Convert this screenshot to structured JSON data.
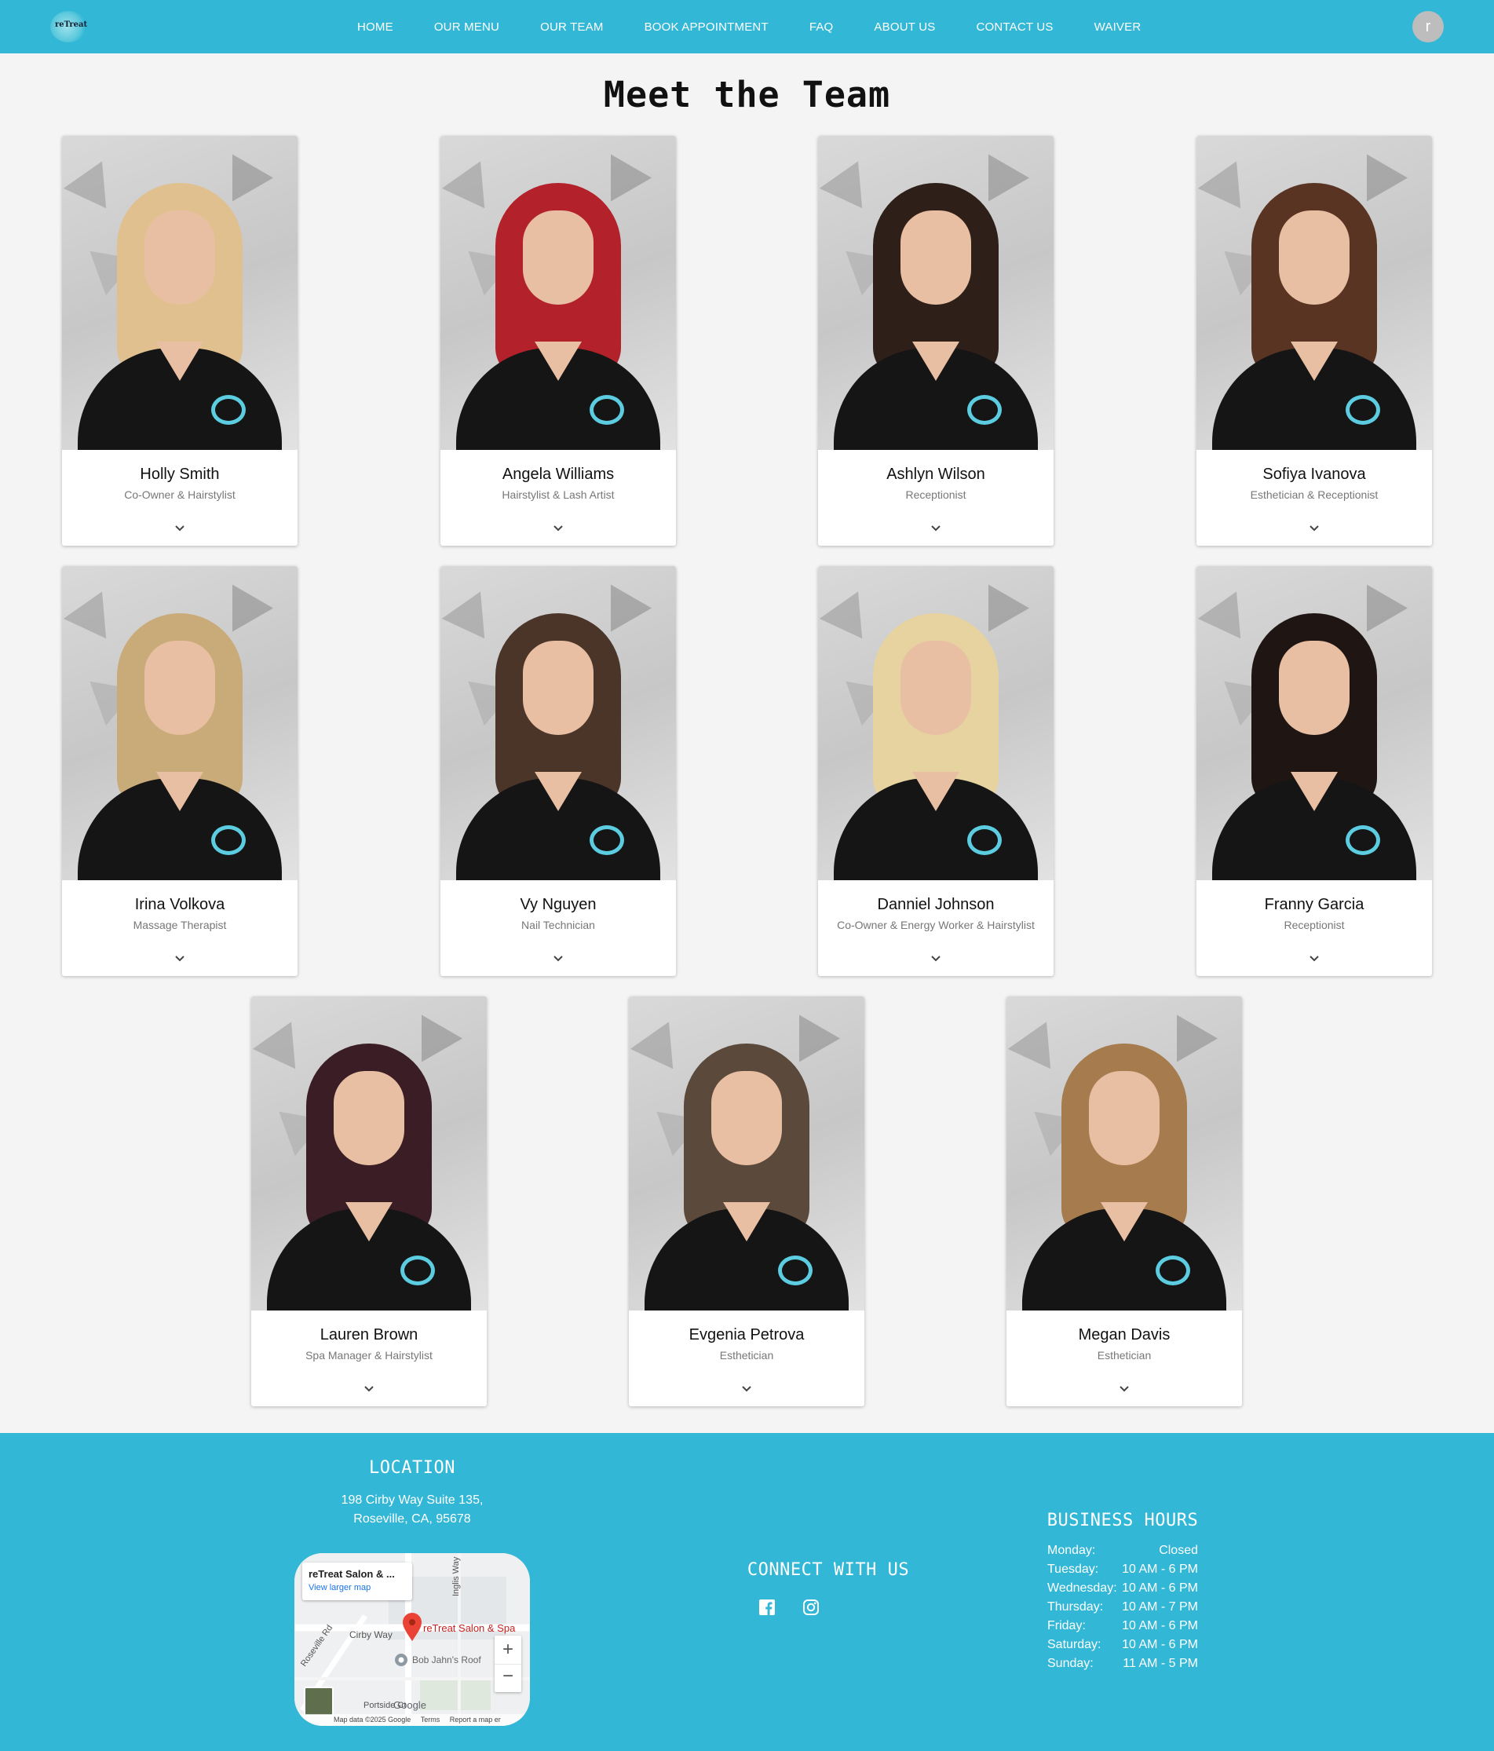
{
  "nav": {
    "logo_text": "reTreat",
    "links": [
      "HOME",
      "OUR MENU",
      "OUR TEAM",
      "BOOK APPOINTMENT",
      "FAQ",
      "ABOUT US",
      "CONTACT US",
      "WAIVER"
    ],
    "avatar_initial": "r"
  },
  "page": {
    "title": "Meet the Team"
  },
  "team": [
    {
      "name": "Holly Smith",
      "role": "Co-Owner & Hairstylist",
      "hair": "#e0c08e"
    },
    {
      "name": "Angela Williams",
      "role": "Hairstylist & Lash Artist",
      "hair": "#b3222b"
    },
    {
      "name": "Ashlyn Wilson",
      "role": "Receptionist",
      "hair": "#2e2019"
    },
    {
      "name": "Sofiya Ivanova",
      "role": "Esthetician & Receptionist",
      "hair": "#5a3422"
    },
    {
      "name": "Irina Volkova",
      "role": "Massage Therapist",
      "hair": "#c9ab79"
    },
    {
      "name": "Vy Nguyen",
      "role": "Nail Technician",
      "hair": "#4a3528"
    },
    {
      "name": "Danniel Johnson",
      "role": "Co-Owner & Energy Worker & Hairstylist",
      "hair": "#e6d3a0"
    },
    {
      "name": "Franny Garcia",
      "role": "Receptionist",
      "hair": "#1f1613"
    },
    {
      "name": "Lauren Brown",
      "role": "Spa Manager & Hairstylist",
      "hair": "#3a1d25"
    },
    {
      "name": "Evgenia Petrova",
      "role": "Esthetician",
      "hair": "#5b4a3c"
    },
    {
      "name": "Megan Davis",
      "role": "Esthetician",
      "hair": "#a67c4f"
    }
  ],
  "footer": {
    "location_heading": "LOCATION",
    "address_line1": "198 Cirby Way Suite 135,",
    "address_line2": "Roseville, CA, 95678",
    "map": {
      "place_title": "reTreat Salon & ...",
      "larger_link": "View larger map",
      "pin_label": "reTreat Salon & Spa",
      "street1": "Cirby Way",
      "street2": "Roseville Rd",
      "street3": "Inglis Way",
      "poi": "Bob Jahn's Roof",
      "street4": "Portside Ct",
      "google": "Google",
      "attribution": "Map data ©2025 Google",
      "terms": "Terms",
      "report": "Report a map er"
    },
    "connect_heading": "CONNECT WITH US",
    "hours_heading": "BUSINESS HOURS",
    "hours": [
      {
        "day": "Monday:",
        "time": "Closed"
      },
      {
        "day": "Tuesday:",
        "time": "10 AM - 6 PM"
      },
      {
        "day": "Wednesday:",
        "time": "10 AM - 6 PM"
      },
      {
        "day": "Thursday:",
        "time": "10 AM - 7 PM"
      },
      {
        "day": "Friday:",
        "time": "10 AM - 6 PM"
      },
      {
        "day": "Saturday:",
        "time": "10 AM - 6 PM"
      },
      {
        "day": "Sunday:",
        "time": "11 AM - 5 PM"
      }
    ]
  },
  "colors": {
    "primary": "#33b7d6",
    "background": "#f4f4f4",
    "card": "#ffffff"
  }
}
